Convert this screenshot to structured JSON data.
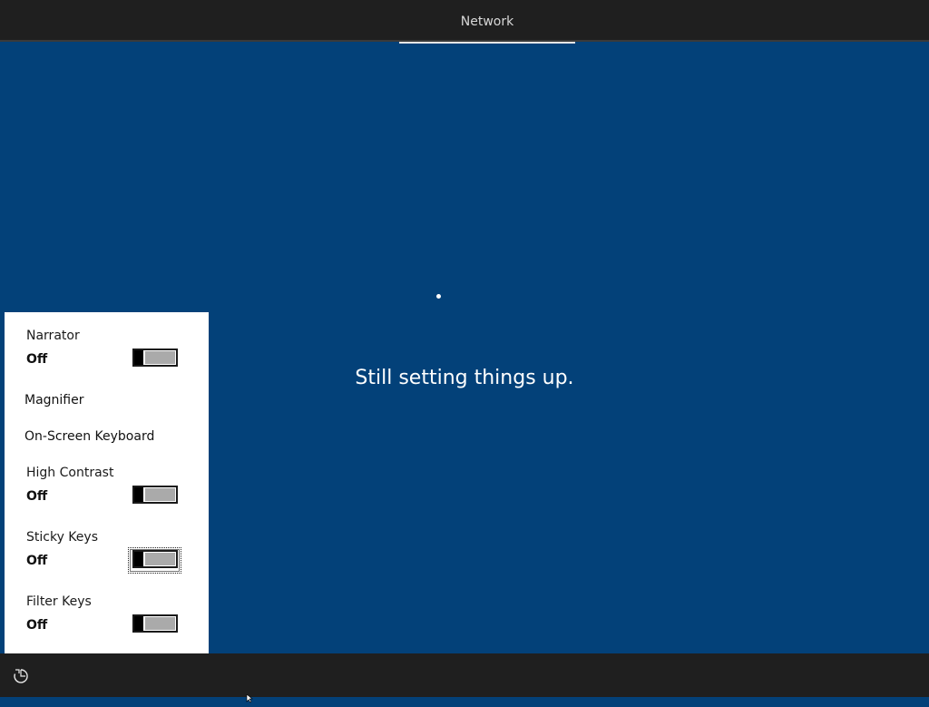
{
  "header": {
    "tab_label": "Network"
  },
  "main": {
    "status_text": "Still setting things up."
  },
  "accessibility_panel": {
    "items": [
      {
        "label": "Narrator",
        "state": "Off"
      },
      {
        "label": "Magnifier"
      },
      {
        "label": "On-Screen Keyboard"
      },
      {
        "label": "High Contrast",
        "state": "Off"
      },
      {
        "label": "Sticky Keys",
        "state": "Off"
      },
      {
        "label": "Filter Keys",
        "state": "Off"
      }
    ]
  },
  "footer": {
    "ease_of_access_icon": "ease-of-access-icon"
  },
  "colors": {
    "background": "#034179",
    "bar": "#1f1f1f",
    "panel": "#ffffff"
  }
}
